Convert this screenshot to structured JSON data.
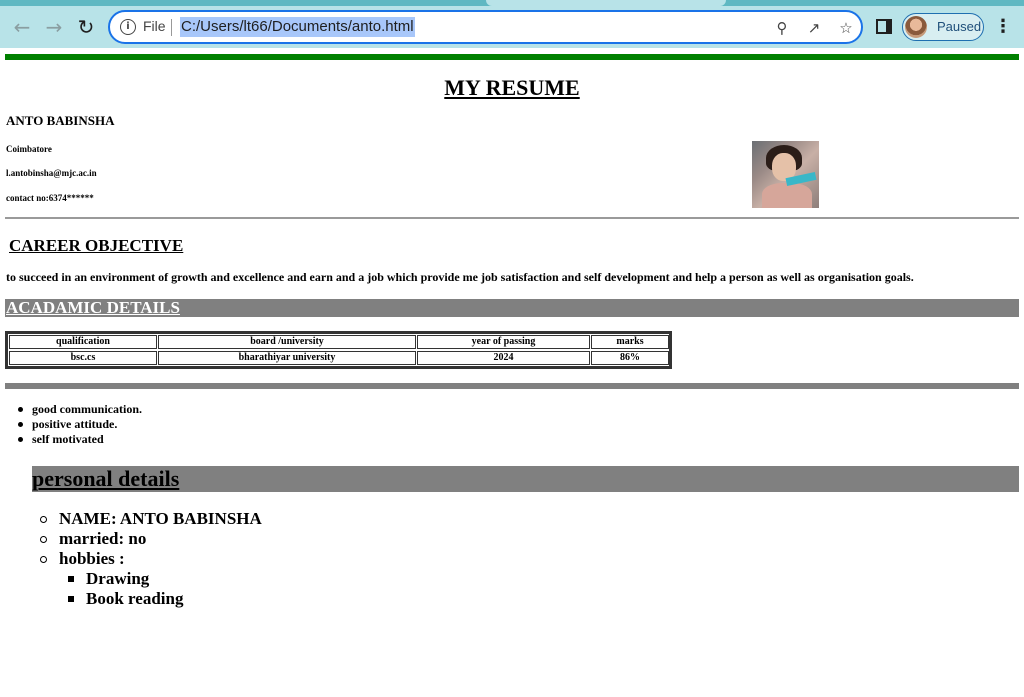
{
  "browser": {
    "url": "C:/Users/lt66/Documents/anto.html",
    "scheme_label": "File",
    "profile_status": "Paused",
    "icons": {
      "back": "arrow-left-icon",
      "forward": "arrow-right-icon",
      "reload": "reload-icon",
      "info": "info-icon",
      "zoom": "zoom-out-icon",
      "share": "share-icon",
      "bookmark": "star-icon",
      "side_panel": "side-panel-icon",
      "menu": "kebab-menu-icon"
    },
    "colors": {
      "toolbar": "#b8e3e8",
      "focus_ring": "#1a73e8",
      "selection": "#a8c7fa"
    }
  },
  "resume": {
    "title": "MY RESUME",
    "name": "ANTO BABINSHA",
    "city": "Coimbatore",
    "email": "l.antobinsha@mjc.ac.in",
    "contact": "contact no:6374******",
    "career_heading": "CAREER OBJECTIVE",
    "career_text": "to succeed in an environment of growth and excellence and earn and a job which provide me job satisfaction and self development and help a person as well as organisation goals.",
    "academic_heading": "ACADAMIC DETAILS",
    "academic_table": {
      "headers": [
        "qualification",
        "board /university",
        "year of passing",
        "marks"
      ],
      "rows": [
        [
          "bsc.cs",
          "bharathiyar university",
          "2024",
          "86%"
        ]
      ]
    },
    "qualities": [
      "good communication.",
      "positive attitude.",
      "self motivated"
    ],
    "personal_heading": "personal details",
    "personal": {
      "name": "NAME: ANTO BABINSHA",
      "married": "married: no",
      "hobbies_label": "hobbies :",
      "hobbies": [
        "Drawing",
        "Book reading"
      ]
    },
    "colors": {
      "top_rule": "#008000",
      "section_bar": "#808080"
    }
  }
}
